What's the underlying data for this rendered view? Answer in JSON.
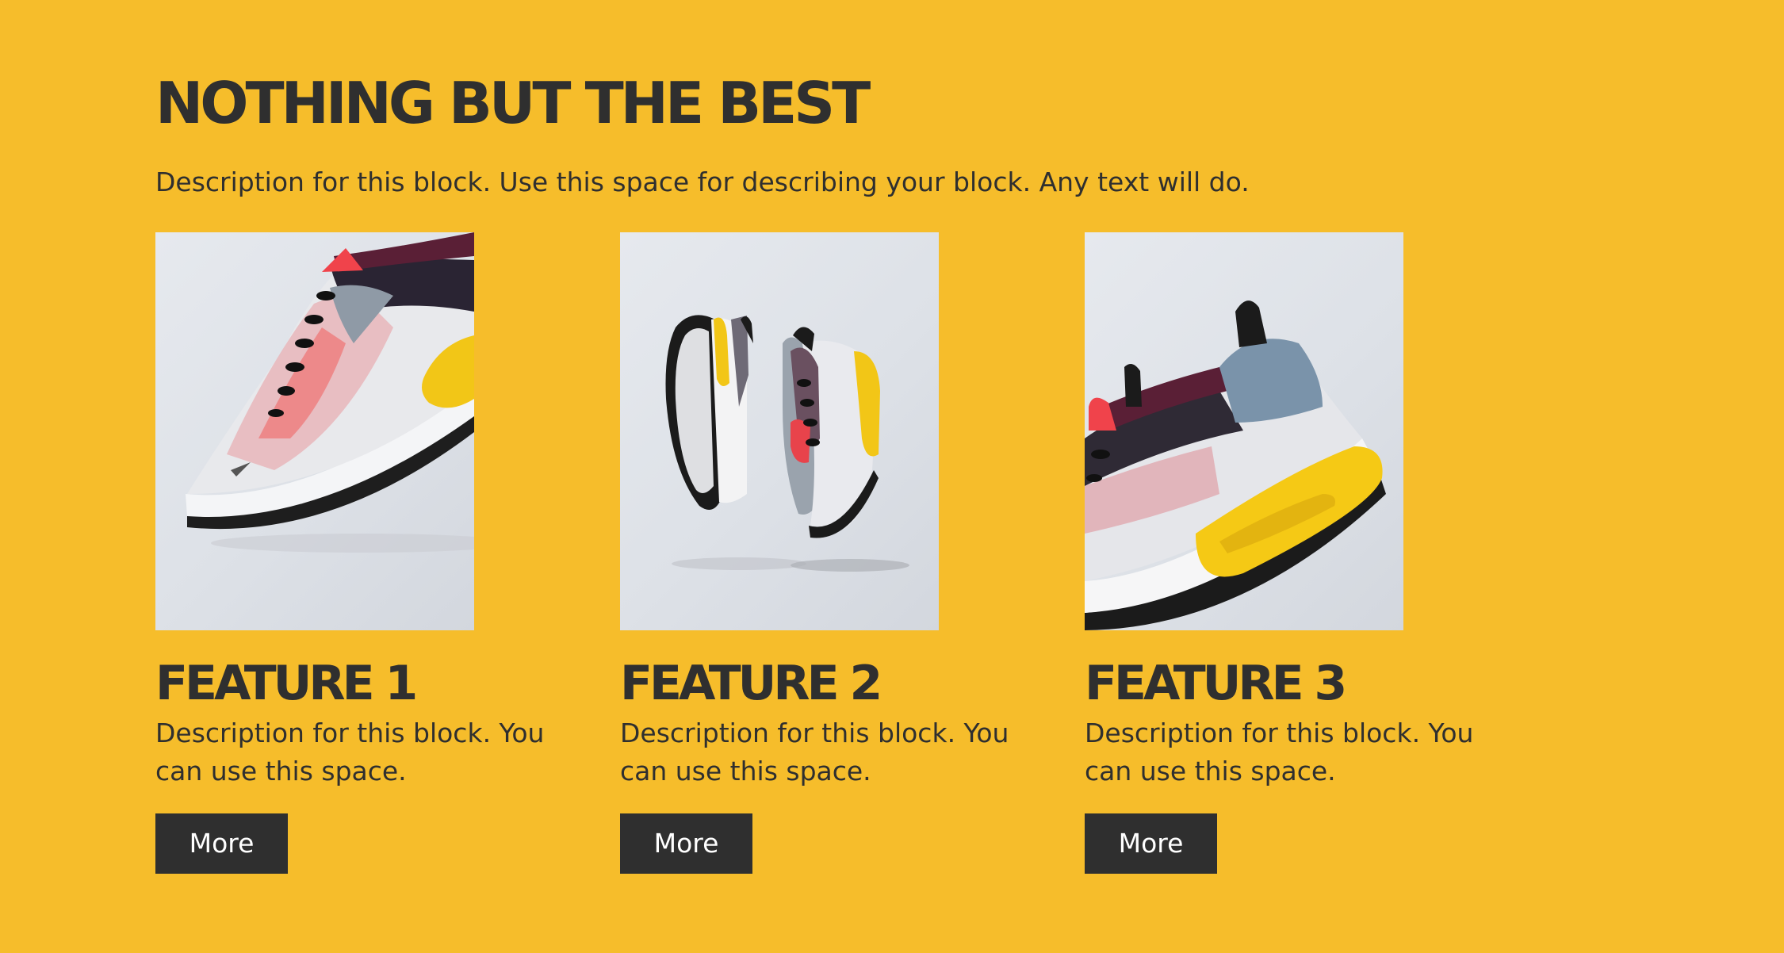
{
  "header": {
    "title": "NOTHING BUT THE BEST",
    "description": "Description for this block. Use this space for describing your block. Any text will do."
  },
  "features": [
    {
      "title": "FEATURE 1",
      "description": "Description for this block. You can use this space.",
      "button_label": "More"
    },
    {
      "title": "FEATURE 2",
      "description": "Description for this block. You can use this space.",
      "button_label": "More"
    },
    {
      "title": "FEATURE 3",
      "description": "Description for this block. You can use this space.",
      "button_label": "More"
    }
  ],
  "colors": {
    "background": "#F6BD2B",
    "text": "#2F2F2F",
    "button_bg": "#2F2F2F",
    "button_text": "#FFFFFF"
  }
}
